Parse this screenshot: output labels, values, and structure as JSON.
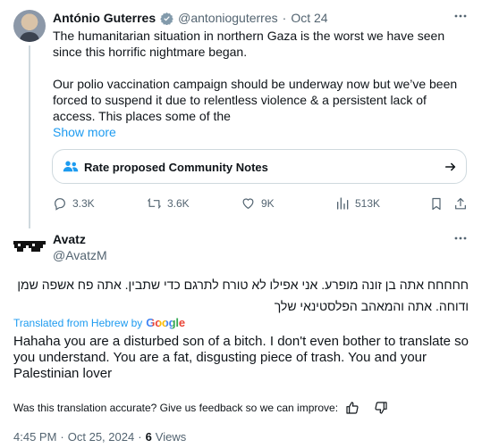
{
  "quoted_tweet": {
    "author_name": "António Guterres",
    "handle": "@antonioguterres",
    "separator": "·",
    "date": "Oct 24",
    "paragraph1": "The humanitarian situation in northern Gaza is the worst we have seen since this horrific nightmare began.",
    "paragraph2": "Our polio vaccination campaign should be underway now but we’ve been forced to suspend it due to relentless violence & a persistent lack of access. This places some of the",
    "show_more": "Show more",
    "community_notes_label": "Rate proposed Community Notes",
    "actions": {
      "replies": "3.3K",
      "reposts": "3.6K",
      "likes": "9K",
      "views": "513K"
    }
  },
  "reply": {
    "author_name": "Avatz",
    "handle": "@AvatzM",
    "hebrew_text": "חחחחח אתה בן זונה מופרע. אני אפילו לא טורח לתרגם כדי שתבין. אתה פח אשפה שמן ודוחה. אתה והמאהב הפלסטינאי שלך",
    "translated_from_label": "Translated from Hebrew by",
    "google_logo_text": "Google",
    "translated_text": "Hahaha you are a disturbed son of a bitch. I don't even bother to translate so you understand. You are a fat, disgusting piece of trash. You and your Palestinian lover",
    "feedback_prompt": "Was this translation accurate? Give us feedback so we can improve:",
    "time": "4:45 PM",
    "date": "Oct 25, 2024",
    "dot1": "·",
    "dot2": "·",
    "views_count": "6",
    "views_label": "Views"
  },
  "colors": {
    "accent": "#1d9bf0",
    "text": "#0f1419",
    "muted": "#536471",
    "border": "#cfd9de",
    "notes_icon": "#1d9bf0"
  },
  "icons": [
    "verified-badge-icon",
    "more-icon",
    "community-notes-icon",
    "arrow-right-icon",
    "reply-icon",
    "repost-icon",
    "like-icon",
    "views-icon",
    "bookmark-icon",
    "share-icon",
    "thumbs-up-icon",
    "thumbs-down-icon"
  ]
}
